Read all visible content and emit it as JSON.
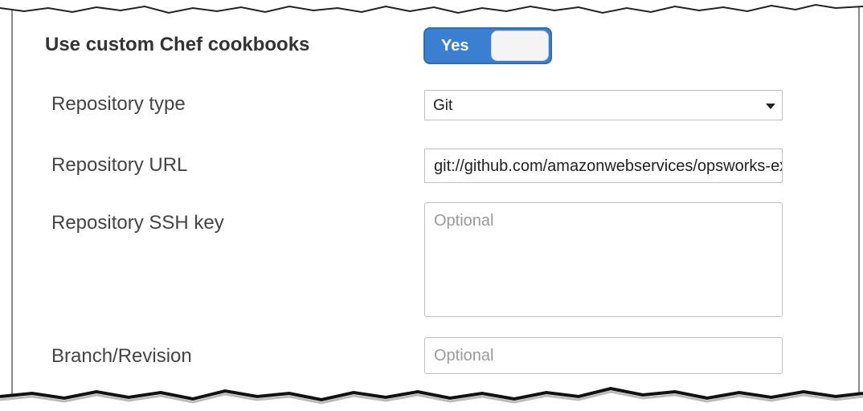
{
  "custom_cookbooks": {
    "label": "Use custom Chef cookbooks",
    "toggle_label": "Yes"
  },
  "fields": {
    "repository_type": {
      "label": "Repository type",
      "value": "Git"
    },
    "repository_url": {
      "label": "Repository URL",
      "value": "git://github.com/amazonwebservices/opsworks-example-cookbooks.git"
    },
    "repository_ssh_key": {
      "label": "Repository SSH key",
      "placeholder": "Optional"
    },
    "branch_revision": {
      "label": "Branch/Revision",
      "placeholder": "Optional"
    }
  },
  "icons": {
    "dropdown": "caret-down-icon"
  },
  "colors": {
    "toggle_on": "#3b7fd0",
    "border": "#bfbfbf",
    "placeholder": "#999999"
  }
}
